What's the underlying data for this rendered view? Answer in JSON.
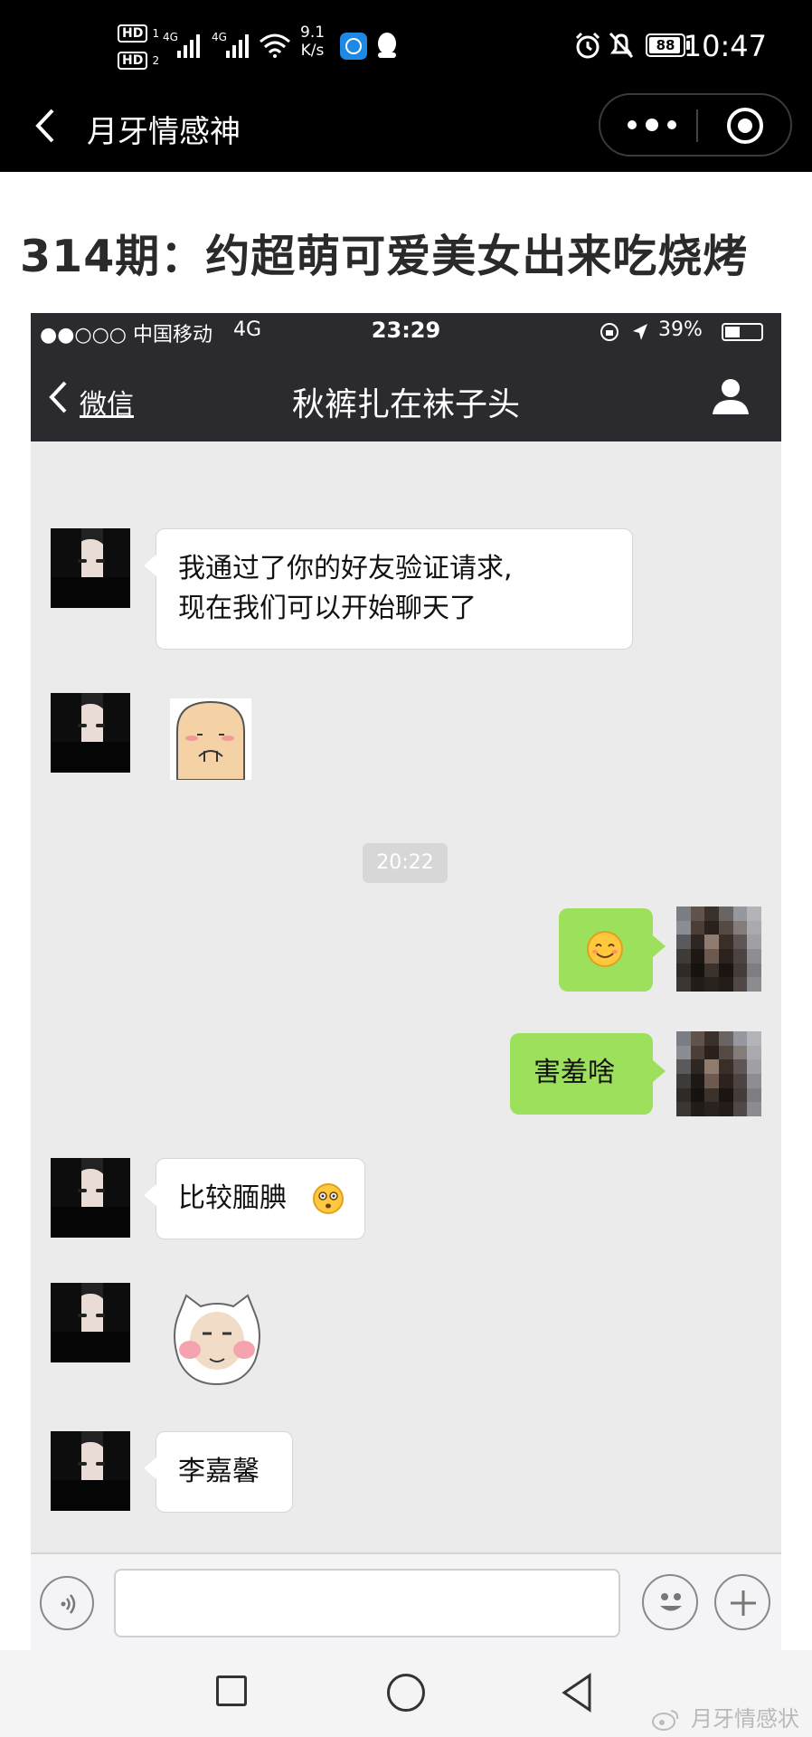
{
  "status_bar": {
    "hd1": "HD",
    "hd2": "HD",
    "sim1": "1",
    "sim2": "2",
    "net1": "4G",
    "net2": "4G",
    "speed_value": "9.1",
    "speed_unit": "K/s",
    "battery": "88",
    "time": "10:47"
  },
  "header": {
    "title": "月牙情感神"
  },
  "article": {
    "title": "314期：约超萌可爱美女出来吃烧烤"
  },
  "chat_screenshot": {
    "status": {
      "carrier": "●●○○○ 中国移动",
      "network": "4G",
      "time": "23:29",
      "battery": "39%"
    },
    "nav": {
      "back_label": "微信",
      "title": "秋裤扎在袜子头"
    },
    "messages": [
      {
        "side": "left",
        "line1": "我通过了你的好友验证请求,",
        "line2": "现在我们可以开始聊天了"
      },
      {
        "side": "left",
        "type": "sticker",
        "sticker": "bald-face-sticker"
      },
      {
        "side": "center",
        "type": "timestamp",
        "text": "20:22"
      },
      {
        "side": "right",
        "type": "emoji",
        "emoji": "smile-emoji"
      },
      {
        "side": "right",
        "text": "害羞啥"
      },
      {
        "side": "left",
        "text": "比较腼腆"
      },
      {
        "side": "left",
        "type": "sticker",
        "sticker": "blushing-cat-sticker"
      },
      {
        "side": "left",
        "text": "李嘉馨"
      }
    ]
  },
  "watermark": "月牙情感状",
  "colors": {
    "accent_green": "#9de05b",
    "nav_dark": "#2b2b2f"
  }
}
